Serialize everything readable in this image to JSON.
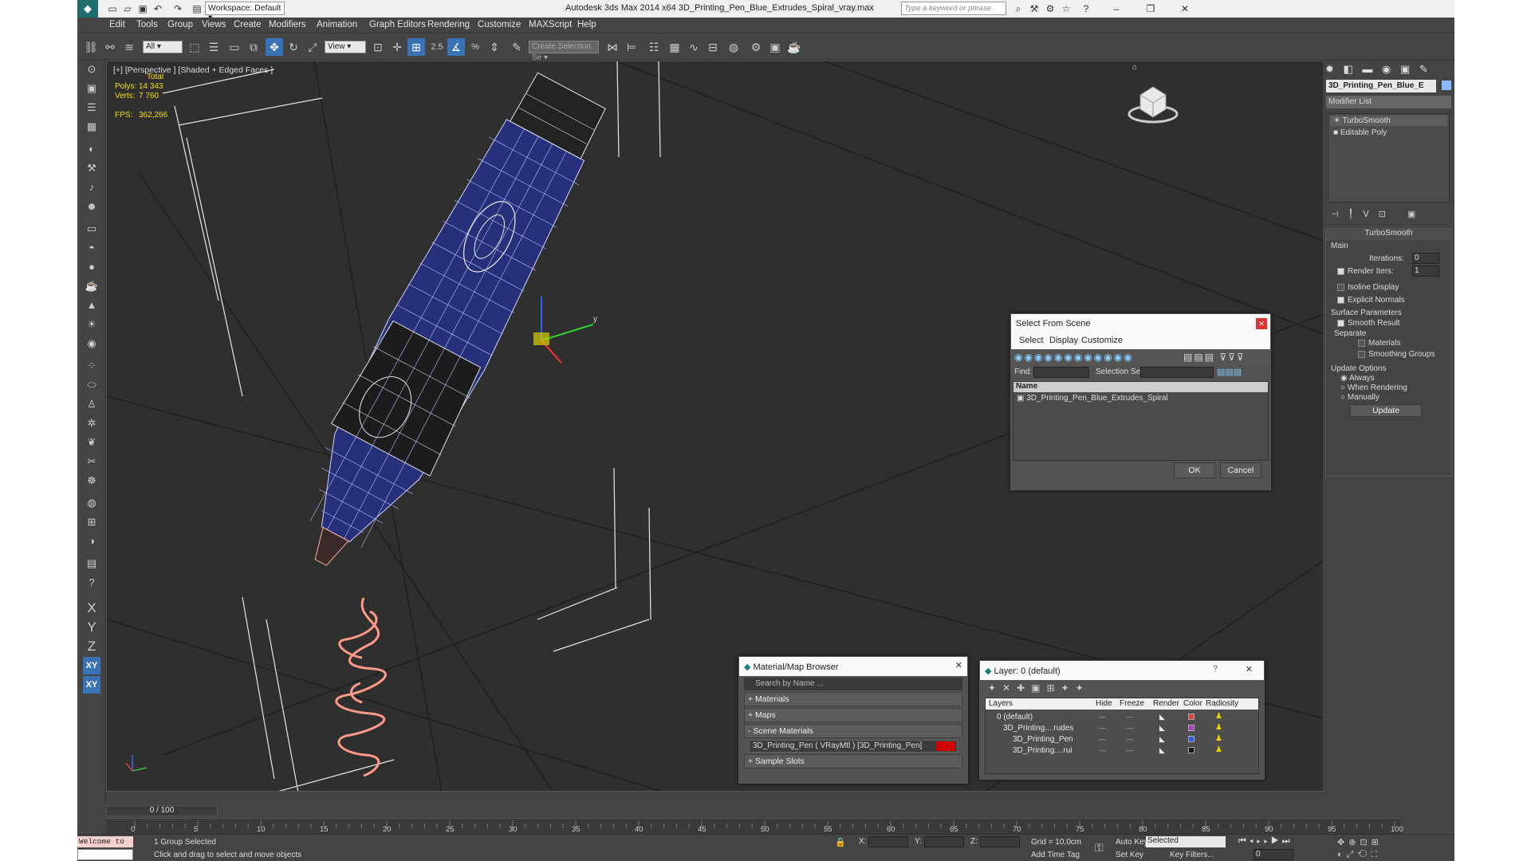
{
  "app": {
    "title": "Autodesk 3ds Max  2014 x64    3D_Printing_Pen_Blue_Extrudes_Spiral_vray.max",
    "workspace": "Workspace: Default",
    "search_placeholder": "Type a keyword or phrase"
  },
  "menu": [
    "Edit",
    "Tools",
    "Group",
    "Views",
    "Create",
    "Modifiers",
    "Animation",
    "Graph Editors",
    "Rendering",
    "Customize",
    "MAXScript",
    "Help"
  ],
  "toolbar": {
    "filter": "All",
    "refcoord": "View",
    "selset": "Create Selection Se",
    "snap25": "2.5",
    "pct": "%"
  },
  "viewport": {
    "label": "[+] [Perspective ] [Shaded + Edged Faces ]",
    "stats": {
      "total": "Total",
      "polys_label": "Polys:",
      "polys": "14 343",
      "verts_label": "Verts:",
      "verts": "7 760",
      "fps_label": "FPS:",
      "fps": "362,266"
    },
    "axis_x": "x",
    "axis_y": "y"
  },
  "cmd": {
    "object_name": "3D_Printing_Pen_Blue_E",
    "modifier_list": "Modifier List",
    "stack": [
      "TurboSmooth",
      "Editable Poly"
    ],
    "rollout": "TurboSmooth",
    "main": "Main",
    "iterations_label": "Iterations:",
    "iterations": "0",
    "render_iters_label": "Render Iters:",
    "render_iters": "1",
    "isoline": "Isoline Display",
    "explicit": "Explicit Normals",
    "surface": "Surface Parameters",
    "smooth_result": "Smooth Result",
    "separate": "Separate",
    "materials": "Materials",
    "smoothing": "Smoothing Groups",
    "update_options": "Update Options",
    "always": "Always",
    "when_rendering": "When Rendering",
    "manually": "Manually",
    "update": "Update"
  },
  "select_dialog": {
    "title": "Select From Scene",
    "menu": [
      "Select",
      "Display",
      "Customize"
    ],
    "find": "Find:",
    "selection_set": "Selection Set:",
    "col_name": "Name",
    "item": "3D_Printing_Pen_Blue_Extrudes_Spiral",
    "ok": "OK",
    "cancel": "Cancel"
  },
  "mat_browser": {
    "title": "Material/Map Browser",
    "search": "Search by Name ...",
    "rollouts": [
      "+ Materials",
      "+ Maps",
      "- Scene Materials",
      "+ Sample Slots"
    ],
    "scene_mat": "3D_Printing_Pen  ( VRayMtl ) [3D_Printing_Pen]"
  },
  "layer_dialog": {
    "title": "Layer: 0 (default)",
    "help": "?",
    "cols": [
      "Layers",
      "Hide",
      "Freeze",
      "Render",
      "Color",
      "Radiosity"
    ],
    "rows": [
      "0 (default)",
      "3D_Printing....rudes",
      "3D_Printing_Pen",
      "3D_Printing....rui"
    ],
    "colors": [
      "#e04040",
      "#b040c0",
      "#3060e0",
      "#111111"
    ]
  },
  "timeline": {
    "frame": "0 / 100",
    "ticks": [
      "0",
      "5",
      "10",
      "15",
      "20",
      "25",
      "30",
      "35",
      "40",
      "45",
      "50",
      "55",
      "60",
      "65",
      "70",
      "75",
      "80",
      "85",
      "90",
      "95",
      "100"
    ]
  },
  "status": {
    "maxscript": "Welcome to M",
    "selected": "1 Group Selected",
    "prompt": "Click and drag to select and move objects",
    "x": "X:",
    "y": "Y:",
    "z": "Z:",
    "grid": "Grid = 10,0cm",
    "add_time_tag": "Add Time Tag",
    "auto_key": "Auto Key",
    "set_key": "Set Key",
    "selected_combo": "Selected",
    "key_filters": "Key Filters...",
    "frame": "0"
  },
  "lefticons": [
    "X",
    "Y",
    "Z",
    "XY",
    "XY"
  ]
}
